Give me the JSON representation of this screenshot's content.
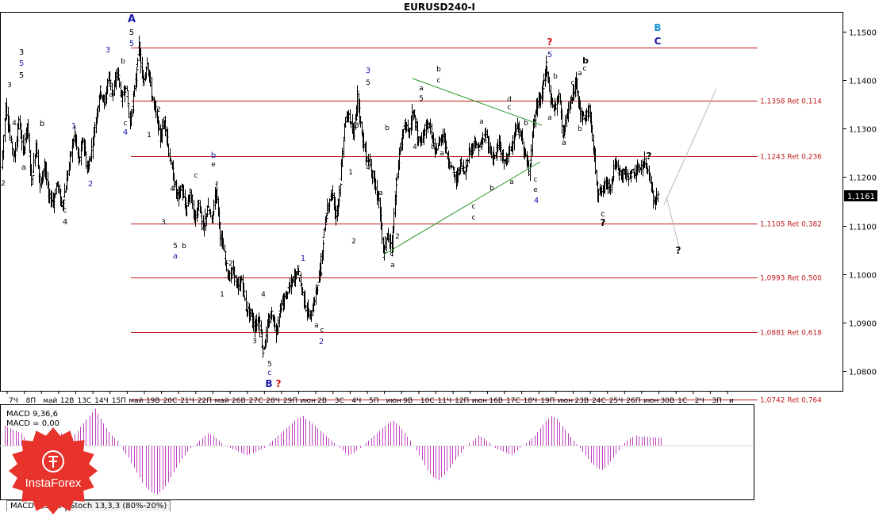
{
  "window": {
    "title": "EURUSD240-I"
  },
  "price_labels": [
    "1,1500",
    "1,1400",
    "1,1300",
    "1,1200",
    "1,1100",
    "1,1000",
    "1,0900",
    "1,0800"
  ],
  "current_price": {
    "value": 1.1161,
    "label": "1,1161"
  },
  "date_labels": [
    "7Ч",
    "8П",
    "май",
    "12В",
    "13С",
    "14Ч",
    "15П",
    "май",
    "19В",
    "20С",
    "21Ч",
    "22П",
    "май",
    "26В",
    "27С",
    "28Ч",
    "29П",
    "июн",
    "2В",
    "3С",
    "4Ч",
    "5П",
    "июн",
    "9В",
    "10С",
    "11Ч",
    "12П",
    "июн",
    "16В",
    "17С",
    "18Ч",
    "19П",
    "июн",
    "23В",
    "24С",
    "25Ч",
    "26П",
    "июн",
    "30В",
    "1С",
    "2Ч",
    "3П",
    "и"
  ],
  "fib_lines": [
    {
      "price": 1.1466,
      "label": ""
    },
    {
      "price": 1.1358,
      "label": "1,1358 Ret 0,114"
    },
    {
      "price": 1.1243,
      "label": "1,1243 Ret 0,236"
    },
    {
      "price": 1.1105,
      "label": "1,1105 Ret 0,382"
    },
    {
      "price": 1.0993,
      "label": "1,0993 Ret 0,500"
    },
    {
      "price": 1.0881,
      "label": "1,0881 Ret 0,618"
    },
    {
      "price": 1.0742,
      "label": "1,0742 Ret 0,764"
    }
  ],
  "wave_labels": [
    {
      "t": "A",
      "x": 166,
      "y": 28,
      "c": "#1a1aa8",
      "s": 13
    },
    {
      "t": "5",
      "x": 166,
      "y": 44,
      "c": "#000",
      "s": 10
    },
    {
      "t": "5",
      "x": 166,
      "y": 58,
      "c": "#1a1aa8",
      "s": 10
    },
    {
      "t": "3",
      "x": 27,
      "y": 69,
      "c": "#000",
      "s": 10
    },
    {
      "t": "5",
      "x": 27,
      "y": 83,
      "c": "#1a1aa8",
      "s": 10
    },
    {
      "t": "5",
      "x": 27,
      "y": 98,
      "c": "#000",
      "s": 10
    },
    {
      "t": "3",
      "x": 12,
      "y": 110,
      "c": "#000",
      "s": 9
    },
    {
      "t": "4",
      "x": 18,
      "y": 158,
      "c": "#000",
      "s": 9
    },
    {
      "t": "b",
      "x": 53,
      "y": 159,
      "c": "#000",
      "s": 10
    },
    {
      "t": "a",
      "x": 30,
      "y": 214,
      "c": "#000",
      "s": 10
    },
    {
      "t": "2",
      "x": 4,
      "y": 234,
      "c": "#000",
      "s": 9
    },
    {
      "t": "c",
      "x": 82,
      "y": 268,
      "c": "#000",
      "s": 10
    },
    {
      "t": "4",
      "x": 82,
      "y": 283,
      "c": "#000",
      "s": 10
    },
    {
      "t": "1",
      "x": 93,
      "y": 162,
      "c": "#1a1aa8",
      "s": 10
    },
    {
      "t": "2",
      "x": 114,
      "y": 235,
      "c": "#1a1aa8",
      "s": 10
    },
    {
      "t": "3",
      "x": 136,
      "y": 66,
      "c": "#1a1aa8",
      "s": 10
    },
    {
      "t": "b",
      "x": 155,
      "y": 80,
      "c": "#000",
      "s": 9
    },
    {
      "t": "a",
      "x": 140,
      "y": 122,
      "c": "#000",
      "s": 9
    },
    {
      "t": "c",
      "x": 158,
      "y": 158,
      "c": "#000",
      "s": 9
    },
    {
      "t": "4",
      "x": 158,
      "y": 170,
      "c": "#1a1aa8",
      "s": 10
    },
    {
      "t": "2",
      "x": 200,
      "y": 141,
      "c": "#000",
      "s": 9
    },
    {
      "t": "1",
      "x": 188,
      "y": 173,
      "c": "#000",
      "s": 9
    },
    {
      "t": "b",
      "x": 269,
      "y": 199,
      "c": "#1a1aa8",
      "s": 10
    },
    {
      "t": "e",
      "x": 269,
      "y": 210,
      "c": "#000",
      "s": 9
    },
    {
      "t": "c",
      "x": 247,
      "y": 224,
      "c": "#000",
      "s": 9
    },
    {
      "t": "4",
      "x": 217,
      "y": 241,
      "c": "#000",
      "s": 9
    },
    {
      "t": "a",
      "x": 226,
      "y": 245,
      "c": "#000",
      "s": 9
    },
    {
      "t": "3",
      "x": 206,
      "y": 283,
      "c": "#000",
      "s": 9
    },
    {
      "t": "d",
      "x": 258,
      "y": 291,
      "c": "#000",
      "s": 9
    },
    {
      "t": "5",
      "x": 221,
      "y": 313,
      "c": "#000",
      "s": 9
    },
    {
      "t": "b",
      "x": 232,
      "y": 313,
      "c": "#000",
      "s": 9
    },
    {
      "t": "a",
      "x": 221,
      "y": 326,
      "c": "#1a1aa8",
      "s": 10
    },
    {
      "t": "2",
      "x": 291,
      "y": 335,
      "c": "#000",
      "s": 9
    },
    {
      "t": "1",
      "x": 280,
      "y": 374,
      "c": "#000",
      "s": 9
    },
    {
      "t": "4",
      "x": 332,
      "y": 374,
      "c": "#000",
      "s": 9
    },
    {
      "t": "3",
      "x": 321,
      "y": 433,
      "c": "#000",
      "s": 9
    },
    {
      "t": "5",
      "x": 340,
      "y": 462,
      "c": "#000",
      "s": 9
    },
    {
      "t": "c",
      "x": 340,
      "y": 473,
      "c": "#1a1aa8",
      "s": 10
    },
    {
      "t": "B",
      "x": 339,
      "y": 488,
      "c": "#1a1aa8",
      "s": 12
    },
    {
      "t": "?",
      "x": 351,
      "y": 488,
      "c": "#d01010",
      "s": 12
    },
    {
      "t": "1",
      "x": 382,
      "y": 329,
      "c": "#1a1aa8",
      "s": 10
    },
    {
      "t": "b",
      "x": 404,
      "y": 348,
      "c": "#000",
      "s": 9
    },
    {
      "t": "a",
      "x": 399,
      "y": 413,
      "c": "#000",
      "s": 9
    },
    {
      "t": "c",
      "x": 406,
      "y": 419,
      "c": "#000",
      "s": 9
    },
    {
      "t": "2",
      "x": 405,
      "y": 434,
      "c": "#1a1aa8",
      "s": 10
    },
    {
      "t": "3",
      "x": 464,
      "y": 92,
      "c": "#1a1aa8",
      "s": 10
    },
    {
      "t": "5",
      "x": 464,
      "y": 107,
      "c": "#000",
      "s": 9
    },
    {
      "t": "3",
      "x": 450,
      "y": 161,
      "c": "#000",
      "s": 9
    },
    {
      "t": "4",
      "x": 464,
      "y": 214,
      "c": "#000",
      "s": 9
    },
    {
      "t": "1",
      "x": 442,
      "y": 220,
      "c": "#000",
      "s": 9
    },
    {
      "t": "2",
      "x": 446,
      "y": 307,
      "c": "#000",
      "s": 9
    },
    {
      "t": "b",
      "x": 488,
      "y": 164,
      "c": "#000",
      "s": 9
    },
    {
      "t": "a",
      "x": 480,
      "y": 246,
      "c": "#000",
      "s": 9
    },
    {
      "t": "1",
      "x": 499,
      "y": 248,
      "c": "#000",
      "s": 9
    },
    {
      "t": "2",
      "x": 501,
      "y": 301,
      "c": "#000",
      "s": 9
    },
    {
      "t": "c",
      "x": 494,
      "y": 323,
      "c": "#000",
      "s": 9
    },
    {
      "t": "a",
      "x": 495,
      "y": 337,
      "c": "#000",
      "s": 9
    },
    {
      "t": "b",
      "x": 553,
      "y": 90,
      "c": "#000",
      "s": 9
    },
    {
      "t": "c",
      "x": 553,
      "y": 104,
      "c": "#000",
      "s": 9
    },
    {
      "t": "a",
      "x": 531,
      "y": 114,
      "c": "#000",
      "s": 9
    },
    {
      "t": "5",
      "x": 531,
      "y": 127,
      "c": "#000",
      "s": 9
    },
    {
      "t": "3",
      "x": 520,
      "y": 152,
      "c": "#000",
      "s": 9
    },
    {
      "t": "4",
      "x": 523,
      "y": 188,
      "c": "#000",
      "s": 9
    },
    {
      "t": "b",
      "x": 546,
      "y": 188,
      "c": "#000",
      "s": 9
    },
    {
      "t": "a",
      "x": 557,
      "y": 196,
      "c": "#000",
      "s": 9
    },
    {
      "t": "d",
      "x": 642,
      "y": 128,
      "c": "#000",
      "s": 9
    },
    {
      "t": "c",
      "x": 642,
      "y": 138,
      "c": "#000",
      "s": 9
    },
    {
      "t": "a",
      "x": 607,
      "y": 156,
      "c": "#000",
      "s": 9
    },
    {
      "t": "e",
      "x": 607,
      "y": 185,
      "c": "#000",
      "s": 9
    },
    {
      "t": "b",
      "x": 620,
      "y": 240,
      "c": "#000",
      "s": 9
    },
    {
      "t": "c",
      "x": 597,
      "y": 263,
      "c": "#000",
      "s": 9
    },
    {
      "t": "c",
      "x": 597,
      "y": 277,
      "c": "#000",
      "s": 9
    },
    {
      "t": "a",
      "x": 645,
      "y": 232,
      "c": "#000",
      "s": 9
    },
    {
      "t": "b",
      "x": 663,
      "y": 158,
      "c": "#000",
      "s": 9
    },
    {
      "t": "c",
      "x": 675,
      "y": 229,
      "c": "#000",
      "s": 9
    },
    {
      "t": "e",
      "x": 675,
      "y": 242,
      "c": "#000",
      "s": 9
    },
    {
      "t": "4",
      "x": 676,
      "y": 256,
      "c": "#1a1aa8",
      "s": 10
    },
    {
      "t": "?",
      "x": 693,
      "y": 57,
      "c": "#d01010",
      "s": 12
    },
    {
      "t": "5",
      "x": 693,
      "y": 72,
      "c": "#1a1aa8",
      "s": 10
    },
    {
      "t": "b",
      "x": 700,
      "y": 99,
      "c": "#000",
      "s": 9
    },
    {
      "t": "a",
      "x": 693,
      "y": 151,
      "c": "#000",
      "s": 9
    },
    {
      "t": "c",
      "x": 722,
      "y": 107,
      "c": "#000",
      "s": 9
    },
    {
      "t": "b",
      "x": 722,
      "y": 127,
      "c": "#000",
      "s": 9
    },
    {
      "t": "c",
      "x": 711,
      "y": 174,
      "c": "#000",
      "s": 9
    },
    {
      "t": "a",
      "x": 711,
      "y": 183,
      "c": "#000",
      "s": 10
    },
    {
      "t": "b",
      "x": 738,
      "y": 80,
      "c": "#000",
      "s": 11
    },
    {
      "t": "c",
      "x": 737,
      "y": 89,
      "c": "#000",
      "s": 9
    },
    {
      "t": "a",
      "x": 731,
      "y": 95,
      "c": "#000",
      "s": 9
    },
    {
      "t": "b",
      "x": 731,
      "y": 165,
      "c": "#000",
      "s": 9
    },
    {
      "t": "B",
      "x": 829,
      "y": 39,
      "c": "#1a8fd4",
      "s": 12
    },
    {
      "t": "C",
      "x": 829,
      "y": 56,
      "c": "#1a1aa8",
      "s": 12
    },
    {
      "t": "?",
      "x": 818,
      "y": 201,
      "c": "#000",
      "s": 12
    },
    {
      "t": "c",
      "x": 760,
      "y": 273,
      "c": "#000",
      "s": 10
    },
    {
      "t": "?",
      "x": 760,
      "y": 285,
      "c": "#000",
      "s": 12
    },
    {
      "t": "?",
      "x": 855,
      "y": 320,
      "c": "#000",
      "s": 12
    }
  ],
  "indicator": {
    "line1": "MACD 9,36,6",
    "line2": "MACD = 0,00",
    "tabs": [
      "MACD 9,36,6",
      "Stoch 13,3,3 (80%-20%)"
    ]
  },
  "logo": {
    "text": "InstaForex",
    "color": "#e8322c"
  },
  "chart_data": {
    "type": "candlestick",
    "title": "EURUSD240-I",
    "ylim": [
      1.076,
      1.154
    ],
    "y_ticks": [
      1.08,
      1.09,
      1.1,
      1.11,
      1.12,
      1.13,
      1.14,
      1.15
    ],
    "last_price": 1.1161,
    "path": [
      1.122,
      1.135,
      1.128,
      1.124,
      1.132,
      1.125,
      1.131,
      1.119,
      1.127,
      1.118,
      1.123,
      1.116,
      1.115,
      1.119,
      1.114,
      1.118,
      1.124,
      1.129,
      1.123,
      1.128,
      1.121,
      1.126,
      1.132,
      1.138,
      1.135,
      1.141,
      1.137,
      1.142,
      1.136,
      1.139,
      1.131,
      1.138,
      1.147,
      1.139,
      1.144,
      1.137,
      1.133,
      1.128,
      1.132,
      1.125,
      1.12,
      1.116,
      1.118,
      1.113,
      1.117,
      1.111,
      1.115,
      1.109,
      1.114,
      1.111,
      1.118,
      1.108,
      1.104,
      1.099,
      1.101,
      1.097,
      1.099,
      1.093,
      1.092,
      1.089,
      1.091,
      1.084,
      1.089,
      1.092,
      1.088,
      1.093,
      1.095,
      1.097,
      1.099,
      1.101,
      1.097,
      1.093,
      1.091,
      1.095,
      1.099,
      1.107,
      1.114,
      1.117,
      1.112,
      1.119,
      1.131,
      1.133,
      1.128,
      1.137,
      1.129,
      1.124,
      1.123,
      1.118,
      1.115,
      1.104,
      1.108,
      1.106,
      1.119,
      1.126,
      1.131,
      1.129,
      1.134,
      1.128,
      1.127,
      1.131,
      1.13,
      1.125,
      1.127,
      1.129,
      1.124,
      1.122,
      1.119,
      1.123,
      1.121,
      1.125,
      1.127,
      1.126,
      1.127,
      1.129,
      1.125,
      1.124,
      1.127,
      1.123,
      1.124,
      1.127,
      1.13,
      1.129,
      1.125,
      1.121,
      1.131,
      1.135,
      1.137,
      1.143,
      1.136,
      1.134,
      1.137,
      1.129,
      1.133,
      1.136,
      1.14,
      1.133,
      1.132,
      1.134,
      1.126,
      1.117,
      1.117,
      1.119,
      1.118,
      1.123,
      1.121,
      1.121,
      1.12,
      1.121,
      1.121,
      1.122,
      1.123,
      1.121,
      1.115,
      1.116
    ],
    "macd": {
      "name": "MACD 9,36,6",
      "values": [
        0.4,
        0.35,
        0.3,
        0.25,
        0.1,
        -0.05,
        -0.2,
        -0.1,
        0.05,
        0.15,
        0.25,
        0.2,
        0.15,
        0.3,
        0.45,
        0.6,
        0.75,
        0.55,
        0.35,
        0.2,
        0.1,
        -0.1,
        -0.25,
        -0.45,
        -0.65,
        -0.85,
        -0.95,
        -1.0,
        -0.9,
        -0.75,
        -0.55,
        -0.35,
        -0.2,
        -0.05,
        0.05,
        0.15,
        0.25,
        0.2,
        0.1,
        0.0,
        -0.05,
        -0.1,
        -0.15,
        -0.2,
        -0.15,
        -0.1,
        -0.05,
        0.05,
        0.15,
        0.25,
        0.35,
        0.45,
        0.55,
        0.6,
        0.5,
        0.4,
        0.3,
        0.2,
        0.1,
        0.0,
        -0.1,
        -0.2,
        -0.15,
        -0.05,
        0.05,
        0.15,
        0.25,
        0.35,
        0.45,
        0.5,
        0.4,
        0.25,
        0.1,
        -0.1,
        -0.3,
        -0.5,
        -0.65,
        -0.7,
        -0.6,
        -0.45,
        -0.3,
        -0.15,
        0.0,
        0.1,
        0.2,
        0.15,
        0.05,
        -0.05,
        -0.1,
        -0.15,
        -0.2,
        -0.1,
        0.0,
        0.1,
        0.2,
        0.35,
        0.5,
        0.6,
        0.55,
        0.4,
        0.25,
        0.1,
        -0.05,
        -0.2,
        -0.35,
        -0.45,
        -0.5,
        -0.4,
        -0.25,
        -0.1,
        0.05,
        0.15,
        0.2,
        0.18,
        0.18,
        0.17,
        0.16
      ]
    }
  }
}
